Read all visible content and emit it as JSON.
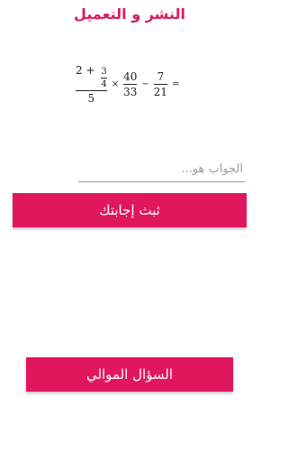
{
  "header": {
    "title": "النشر و التعميل"
  },
  "expression": {
    "big_num_prefix": "2 +",
    "small_num": "3",
    "small_den": "4",
    "den1": "5",
    "times": "×",
    "num2": "40",
    "den2": "33",
    "minus": "−",
    "num3": "7",
    "den3": "21",
    "equals": "="
  },
  "answer": {
    "placeholder": "الجواب هو...",
    "value": ""
  },
  "buttons": {
    "submit_label": "ثبث إجابتك",
    "next_label": "السؤال الموالي"
  },
  "colors": {
    "accent": "#e0165f",
    "title": "#d81b60"
  }
}
